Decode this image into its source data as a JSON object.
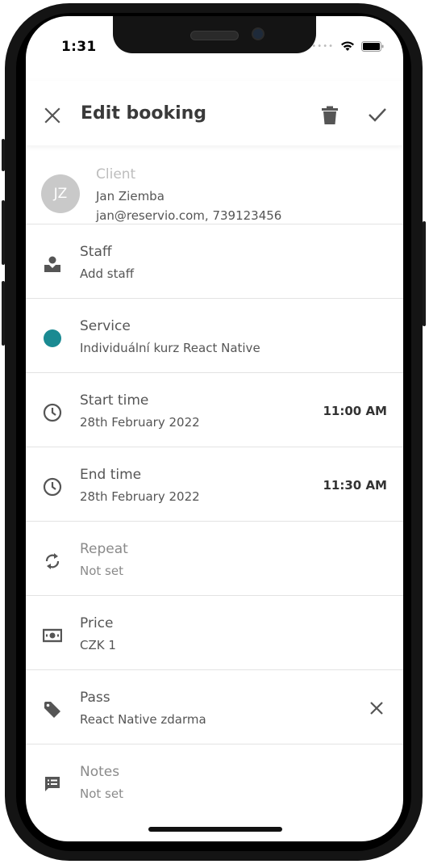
{
  "status_bar": {
    "time": "1:31"
  },
  "header": {
    "title": "Edit booking"
  },
  "client": {
    "label": "Client",
    "initials": "JZ",
    "name": "Jan Ziemba",
    "contact": "jan@reservio.com, 739123456"
  },
  "rows": [
    {
      "label": "Staff",
      "sub": "Add staff",
      "icon": "staff-icon"
    },
    {
      "label": "Service",
      "sub": "Individuální kurz React Native",
      "icon": "service-color-dot",
      "dot_color": "#1a8a92"
    },
    {
      "label": "Start time",
      "sub": "28th February 2022",
      "value": "11:00 AM",
      "icon": "clock-icon"
    },
    {
      "label": "End time",
      "sub": "28th February 2022",
      "value": "11:30 AM",
      "icon": "clock-icon"
    },
    {
      "label": "Repeat",
      "sub": "Not set",
      "icon": "repeat-icon"
    },
    {
      "label": "Price",
      "sub": "CZK 1",
      "icon": "money-icon"
    },
    {
      "label": "Pass",
      "sub": "React Native zdarma",
      "icon": "tag-icon"
    },
    {
      "label": "Notes",
      "sub": "Not set",
      "icon": "notes-icon"
    }
  ]
}
